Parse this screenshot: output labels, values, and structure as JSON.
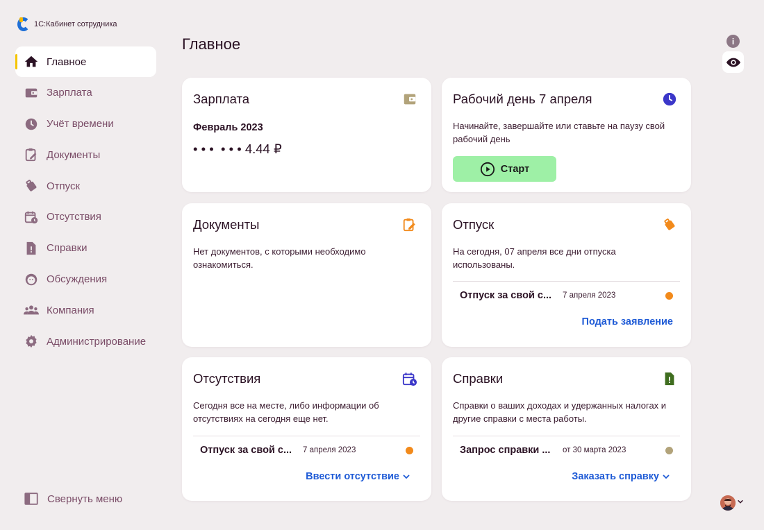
{
  "app": {
    "name": "1С:Кабинет сотрудника"
  },
  "sidebar": {
    "items": [
      {
        "label": "Главное",
        "icon": "home-icon"
      },
      {
        "label": "Зарплата",
        "icon": "wallet-icon"
      },
      {
        "label": "Учёт времени",
        "icon": "clock-icon"
      },
      {
        "label": "Документы",
        "icon": "clipboard-icon"
      },
      {
        "label": "Отпуск",
        "icon": "luggage-icon"
      },
      {
        "label": "Отсутствия",
        "icon": "calendar-clock-icon"
      },
      {
        "label": "Справки",
        "icon": "file-alert-icon"
      },
      {
        "label": "Обсуждения",
        "icon": "chat-face-icon"
      },
      {
        "label": "Компания",
        "icon": "people-icon"
      },
      {
        "label": "Администрирование",
        "icon": "gear-icon"
      }
    ],
    "collapse_label": "Свернуть меню"
  },
  "header": {
    "title": "Главное"
  },
  "cards": {
    "salary": {
      "title": "Зарплата",
      "period": "Февраль 2023",
      "amount": "• • •  • • • 4.44 ₽"
    },
    "workday": {
      "title": "Рабочий день 7 апреля",
      "text": "Начинайте, завершайте или ставьте на паузу свой рабочий день",
      "button": "Старт"
    },
    "documents": {
      "title": "Документы",
      "text": "Нет документов, с которыми необходимо ознакомиться."
    },
    "vacation": {
      "title": "Отпуск",
      "text": "На сегодня, 07 апреля все дни отпуска использованы.",
      "row": {
        "title": "Отпуск за свой с...",
        "date": "7 апреля 2023"
      },
      "link": "Подать заявление"
    },
    "absences": {
      "title": "Отсутствия",
      "text": "Сегодня все на месте, либо информации об отсутствиях на сегодня еще нет.",
      "row": {
        "title": "Отпуск за свой с...",
        "date": "7 апреля 2023"
      },
      "link": "Ввести отсутствие"
    },
    "certificates": {
      "title": "Справки",
      "text": "Справки о ваших доходах и удержанных налогах и другие справки с места работы.",
      "row": {
        "title": "Запрос справки ...",
        "date": "от 30 марта 2023"
      },
      "link": "Заказать справку"
    }
  },
  "colors": {
    "accent_link": "#1f5bd6",
    "status_orange": "#f28a1b",
    "status_gray": "#b2a37a",
    "start_green": "#9ef0a6",
    "active_marker": "#f5c400"
  }
}
